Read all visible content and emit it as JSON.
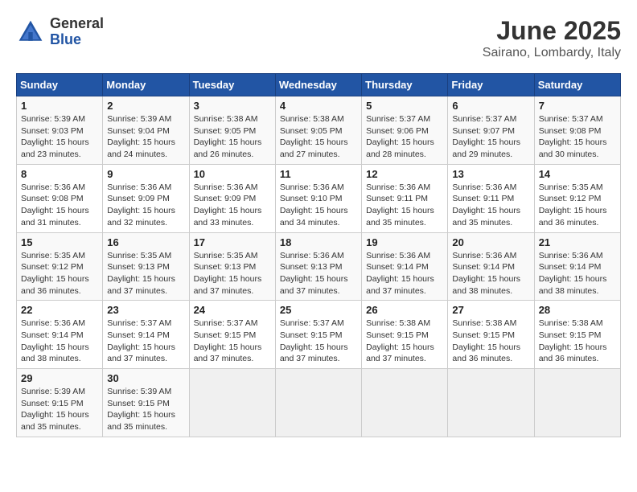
{
  "header": {
    "logo_general": "General",
    "logo_blue": "Blue",
    "month": "June 2025",
    "location": "Sairano, Lombardy, Italy"
  },
  "weekdays": [
    "Sunday",
    "Monday",
    "Tuesday",
    "Wednesday",
    "Thursday",
    "Friday",
    "Saturday"
  ],
  "weeks": [
    [
      {
        "day": "1",
        "sunrise": "5:39 AM",
        "sunset": "9:03 PM",
        "daylight": "15 hours and 23 minutes."
      },
      {
        "day": "2",
        "sunrise": "5:39 AM",
        "sunset": "9:04 PM",
        "daylight": "15 hours and 24 minutes."
      },
      {
        "day": "3",
        "sunrise": "5:38 AM",
        "sunset": "9:05 PM",
        "daylight": "15 hours and 26 minutes."
      },
      {
        "day": "4",
        "sunrise": "5:38 AM",
        "sunset": "9:05 PM",
        "daylight": "15 hours and 27 minutes."
      },
      {
        "day": "5",
        "sunrise": "5:37 AM",
        "sunset": "9:06 PM",
        "daylight": "15 hours and 28 minutes."
      },
      {
        "day": "6",
        "sunrise": "5:37 AM",
        "sunset": "9:07 PM",
        "daylight": "15 hours and 29 minutes."
      },
      {
        "day": "7",
        "sunrise": "5:37 AM",
        "sunset": "9:08 PM",
        "daylight": "15 hours and 30 minutes."
      }
    ],
    [
      {
        "day": "8",
        "sunrise": "5:36 AM",
        "sunset": "9:08 PM",
        "daylight": "15 hours and 31 minutes."
      },
      {
        "day": "9",
        "sunrise": "5:36 AM",
        "sunset": "9:09 PM",
        "daylight": "15 hours and 32 minutes."
      },
      {
        "day": "10",
        "sunrise": "5:36 AM",
        "sunset": "9:09 PM",
        "daylight": "15 hours and 33 minutes."
      },
      {
        "day": "11",
        "sunrise": "5:36 AM",
        "sunset": "9:10 PM",
        "daylight": "15 hours and 34 minutes."
      },
      {
        "day": "12",
        "sunrise": "5:36 AM",
        "sunset": "9:11 PM",
        "daylight": "15 hours and 35 minutes."
      },
      {
        "day": "13",
        "sunrise": "5:36 AM",
        "sunset": "9:11 PM",
        "daylight": "15 hours and 35 minutes."
      },
      {
        "day": "14",
        "sunrise": "5:35 AM",
        "sunset": "9:12 PM",
        "daylight": "15 hours and 36 minutes."
      }
    ],
    [
      {
        "day": "15",
        "sunrise": "5:35 AM",
        "sunset": "9:12 PM",
        "daylight": "15 hours and 36 minutes."
      },
      {
        "day": "16",
        "sunrise": "5:35 AM",
        "sunset": "9:13 PM",
        "daylight": "15 hours and 37 minutes."
      },
      {
        "day": "17",
        "sunrise": "5:35 AM",
        "sunset": "9:13 PM",
        "daylight": "15 hours and 37 minutes."
      },
      {
        "day": "18",
        "sunrise": "5:36 AM",
        "sunset": "9:13 PM",
        "daylight": "15 hours and 37 minutes."
      },
      {
        "day": "19",
        "sunrise": "5:36 AM",
        "sunset": "9:14 PM",
        "daylight": "15 hours and 37 minutes."
      },
      {
        "day": "20",
        "sunrise": "5:36 AM",
        "sunset": "9:14 PM",
        "daylight": "15 hours and 38 minutes."
      },
      {
        "day": "21",
        "sunrise": "5:36 AM",
        "sunset": "9:14 PM",
        "daylight": "15 hours and 38 minutes."
      }
    ],
    [
      {
        "day": "22",
        "sunrise": "5:36 AM",
        "sunset": "9:14 PM",
        "daylight": "15 hours and 38 minutes."
      },
      {
        "day": "23",
        "sunrise": "5:37 AM",
        "sunset": "9:14 PM",
        "daylight": "15 hours and 37 minutes."
      },
      {
        "day": "24",
        "sunrise": "5:37 AM",
        "sunset": "9:15 PM",
        "daylight": "15 hours and 37 minutes."
      },
      {
        "day": "25",
        "sunrise": "5:37 AM",
        "sunset": "9:15 PM",
        "daylight": "15 hours and 37 minutes."
      },
      {
        "day": "26",
        "sunrise": "5:38 AM",
        "sunset": "9:15 PM",
        "daylight": "15 hours and 37 minutes."
      },
      {
        "day": "27",
        "sunrise": "5:38 AM",
        "sunset": "9:15 PM",
        "daylight": "15 hours and 36 minutes."
      },
      {
        "day": "28",
        "sunrise": "5:38 AM",
        "sunset": "9:15 PM",
        "daylight": "15 hours and 36 minutes."
      }
    ],
    [
      {
        "day": "29",
        "sunrise": "5:39 AM",
        "sunset": "9:15 PM",
        "daylight": "15 hours and 35 minutes."
      },
      {
        "day": "30",
        "sunrise": "5:39 AM",
        "sunset": "9:15 PM",
        "daylight": "15 hours and 35 minutes."
      },
      null,
      null,
      null,
      null,
      null
    ]
  ]
}
